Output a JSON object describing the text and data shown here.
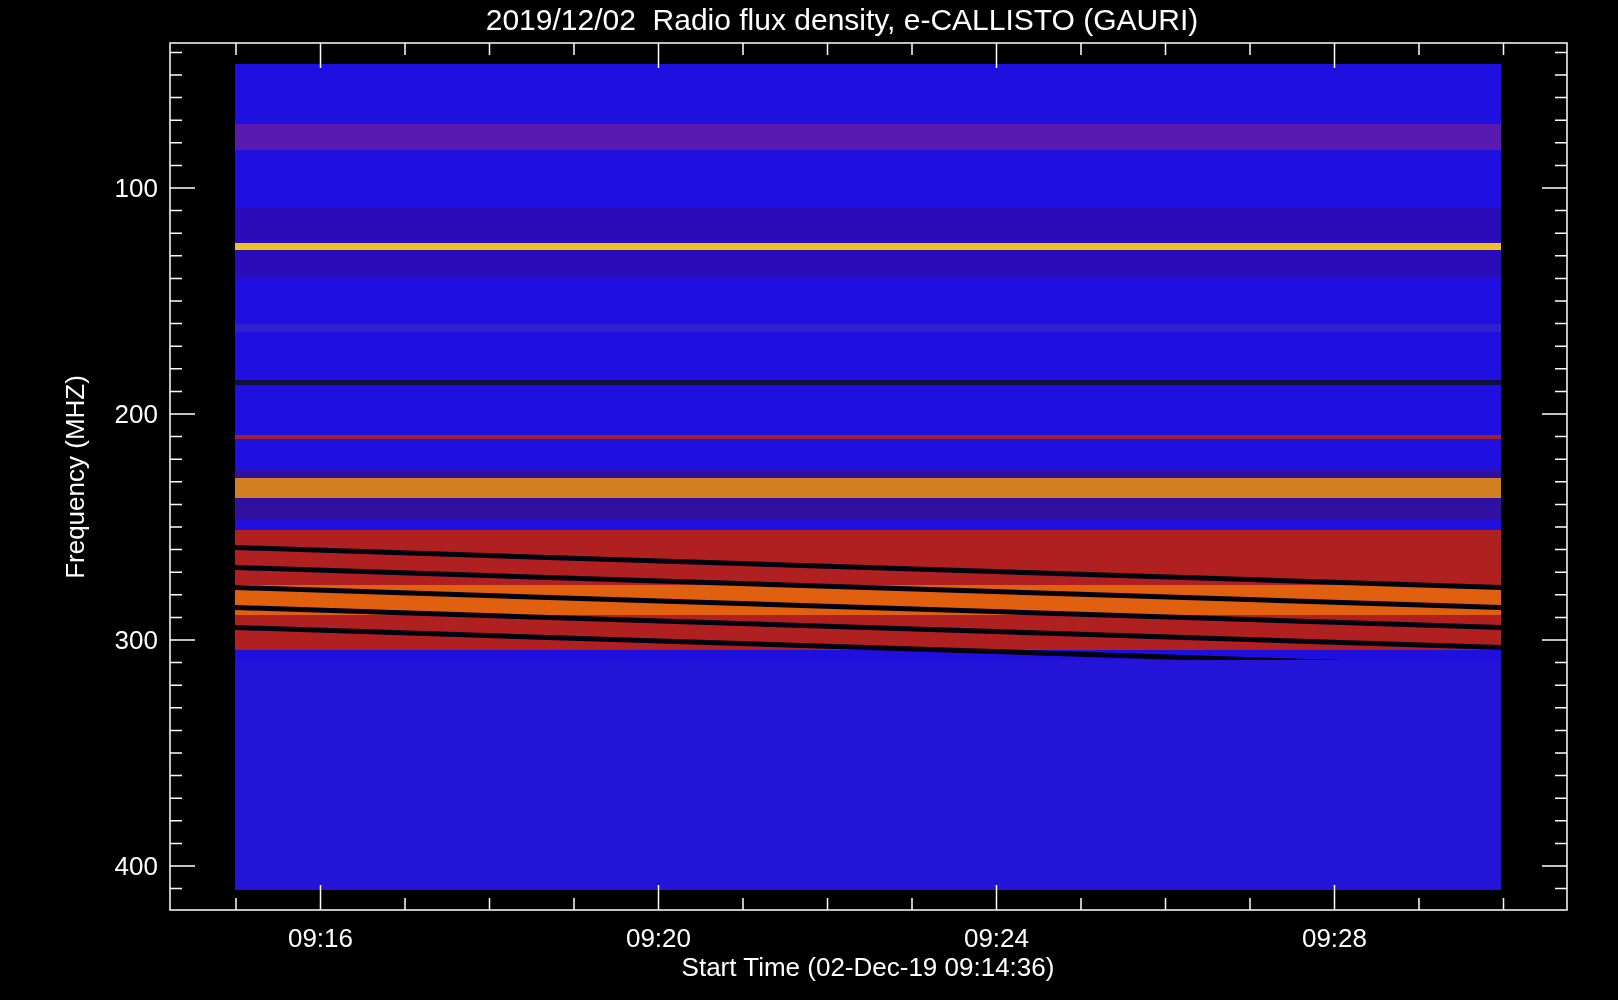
{
  "title": "2019/12/02  Radio flux density, e-CALLISTO (GAURI)",
  "y_axis": {
    "label": "Frequency (MHZ)",
    "ticks": [
      "100",
      "200",
      "300",
      "400"
    ]
  },
  "x_axis": {
    "label": "Start Time (02-Dec-19 09:14:36)",
    "ticks": [
      "09:16",
      "09:20",
      "09:24",
      "09:28"
    ]
  }
}
